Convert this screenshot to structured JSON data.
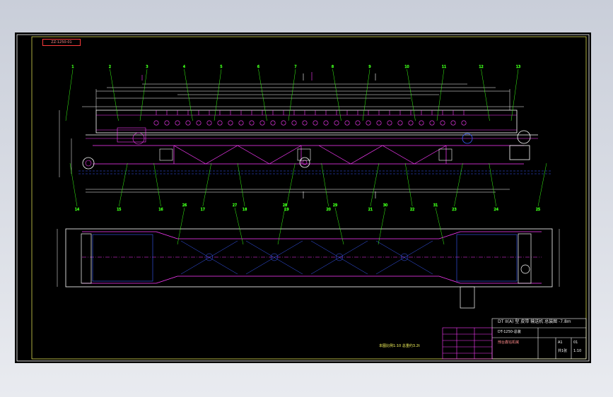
{
  "drawing": {
    "tag": "ZZ-1250-01",
    "title_line": "DT II(A) 型 皮带 输送机 总装图 -7.8m",
    "drawing_no": "DT-1250-总装",
    "company": "邢台鑫钰机械",
    "note": "本图比例1:10 总重约3.2t",
    "scale_label": "1:10"
  },
  "title_block": {
    "sheet_code": "A1",
    "sheet_count": "共1张",
    "rev": "01"
  },
  "colors": {
    "frame": "#ffffff",
    "outline": "#ff3bff",
    "dimension": "#ffffff",
    "leader": "#39ff14",
    "hidden": "#3a5bff",
    "accent_red": "#ff3b3b",
    "yellow": "#f5f55a",
    "cyan": "#3bdcff"
  },
  "balloons_top": [
    "1",
    "2",
    "3",
    "4",
    "5",
    "6",
    "7",
    "8",
    "9",
    "10",
    "11",
    "12",
    "13"
  ],
  "balloons_bottom": [
    "14",
    "15",
    "16",
    "17",
    "18",
    "19",
    "20",
    "21",
    "22",
    "23",
    "24",
    "25"
  ],
  "balloons_plan": [
    "26",
    "27",
    "28",
    "29",
    "30",
    "31"
  ]
}
